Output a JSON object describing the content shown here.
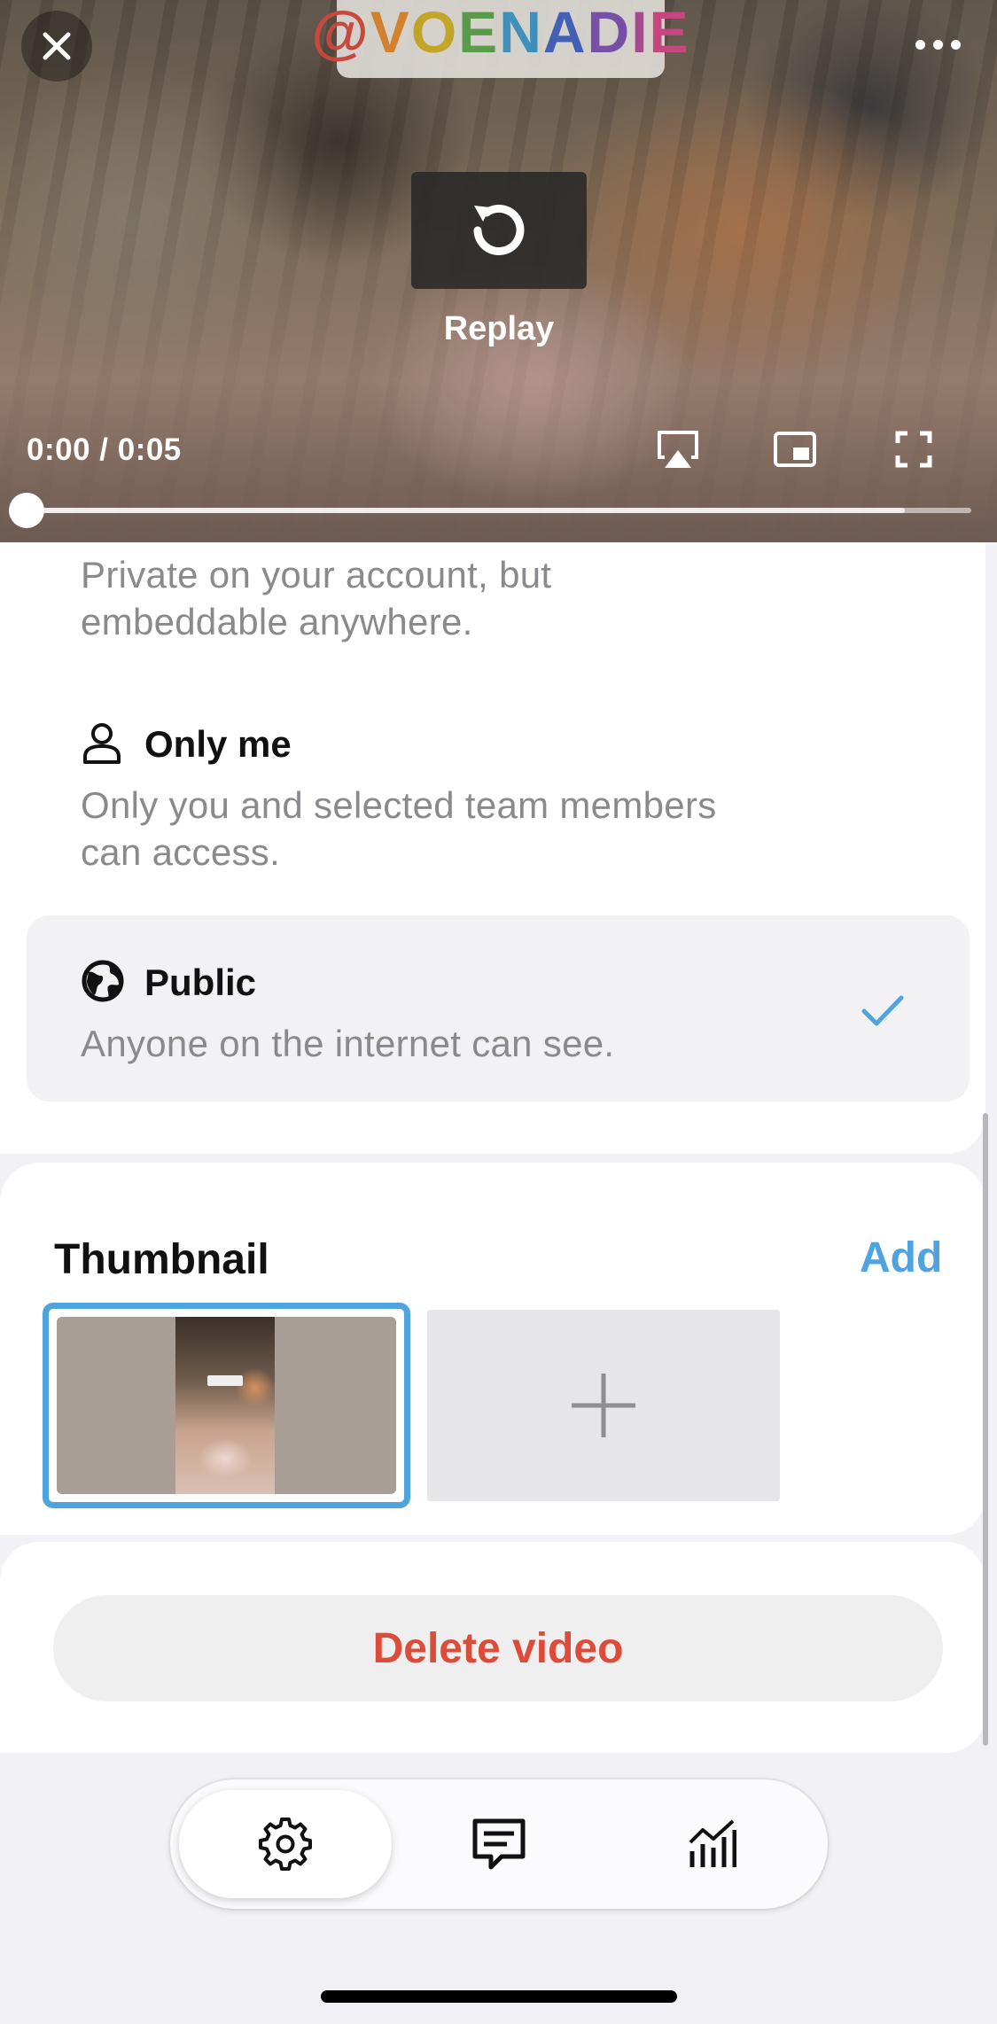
{
  "player": {
    "sticker_text": "@VOENADIE",
    "replay_label": "Replay",
    "time_display": "0:00 / 0:05",
    "progress_fraction": 0.0,
    "buffered_fraction": 0.93,
    "icons": {
      "close": "close-icon",
      "more": "more-icon",
      "replay": "replay-icon",
      "airplay": "airplay-icon",
      "pip": "picture-in-picture-icon",
      "fullscreen": "fullscreen-icon"
    }
  },
  "privacy": {
    "options": [
      {
        "id": "private",
        "title": "",
        "description": "Private on your account, but embeddable anywhere.",
        "selected": false
      },
      {
        "id": "only_me",
        "title": "Only me",
        "description": "Only you and selected team members can access.",
        "icon": "person-icon",
        "selected": false
      },
      {
        "id": "public",
        "title": "Public",
        "description": "Anyone on the internet can see.",
        "icon": "globe-icon",
        "selected": true
      }
    ],
    "private_desc_line1": "Private on your account, but",
    "private_desc_line2": "embeddable anywhere.",
    "only_me_desc_line1": "Only you and selected team members",
    "only_me_desc_line2": "can access."
  },
  "thumbnail": {
    "title": "Thumbnail",
    "add_label": "Add",
    "sticker_mini": "@VOENADIE"
  },
  "actions": {
    "delete_label": "Delete video"
  },
  "tabbar": {
    "tabs": [
      {
        "name": "settings",
        "icon": "gear-icon",
        "active": true
      },
      {
        "name": "comments",
        "icon": "comment-icon",
        "active": false
      },
      {
        "name": "analytics",
        "icon": "chart-icon",
        "active": false
      }
    ]
  },
  "colors": {
    "accent": "#4fa3df",
    "danger": "#dd4b39",
    "muted_text": "#8a8a8e",
    "background": "#f2f2f6"
  }
}
